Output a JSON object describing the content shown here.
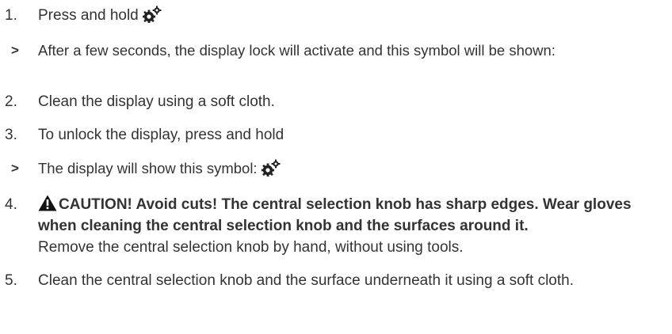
{
  "steps": [
    {
      "number": "1.",
      "text": "Press and hold",
      "icon": "gear-icon"
    },
    {
      "marker": ">",
      "text": "After a few seconds, the display lock will activate and this symbol will be shown:"
    },
    {
      "number": "2.",
      "text": "Clean the display using a soft cloth."
    },
    {
      "number": "3.",
      "text": "To unlock the display, press and hold"
    },
    {
      "marker": ">",
      "text": "The display will show this symbol:",
      "icon": "gear-icon"
    },
    {
      "number": "4.",
      "warning_icon": "warning-triangle-icon",
      "warning_text": "CAUTION! Avoid cuts! The central selection knob has sharp edges. Wear gloves when cleaning the central selection knob and the surfaces around it.",
      "text": "Remove the central selection knob by hand, without using tools."
    },
    {
      "number": "5.",
      "text": "Clean the central selection knob and the surface underneath it using a soft cloth."
    }
  ],
  "colors": {
    "text": "#333333",
    "icon": "#222222"
  }
}
